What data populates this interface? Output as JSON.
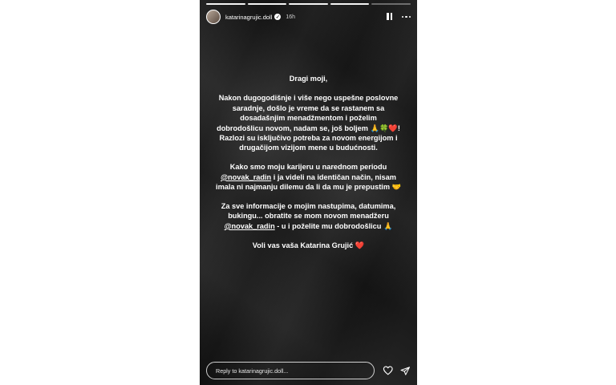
{
  "story": {
    "username": "katarinagrujic.doll",
    "verified_glyph": "✓",
    "time_ago": "16h",
    "progress_segments": [
      true,
      true,
      true,
      true,
      false
    ],
    "icons": {
      "pause": "pause-icon",
      "more": "more-icon",
      "heart": "heart-icon",
      "send": "send-icon"
    }
  },
  "message": {
    "greeting": "Dragi moji,",
    "p1": "Nakon dugogodišnje i više nego uspešne poslovne saradnje, došlo je vreme da se rastanem sa dosadašnjim menadžmentom i poželim dobrodošlicu novom, nadam se, još boljem 🙏🍀❤️!\nRazlozi su isključivo potreba za novom energijom i drugačijom vizijom mene u budućnosti.",
    "p2_before": "Kako smo moju karijeru u narednom periodu ",
    "p2_mention": "@novak_radin",
    "p2_after": " i ja videli na identičan način, nisam imala ni najmanju dilemu da li da mu je prepustim 🤝",
    "p3_before": "Za sve informacije o mojim nastupima, datumima, bukingu... obratite se mom novom menadžeru ",
    "p3_mention": "@novak_radin",
    "p3_after": " - u i poželite mu dobrodošlicu 🙏",
    "signoff": "Voli vas vaša Katarina Grujić ❤️"
  },
  "footer": {
    "reply_placeholder": "Reply to katarinagrujic.doll..."
  }
}
